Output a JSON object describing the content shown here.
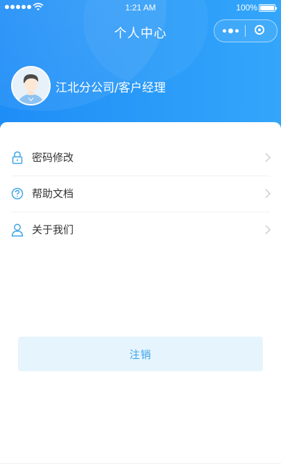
{
  "status_bar": {
    "time": "1:21 AM",
    "battery": "100%"
  },
  "nav": {
    "title": "个人中心"
  },
  "profile": {
    "label": "江北分公司/客户经理"
  },
  "menu": [
    {
      "label": "密码修改",
      "icon": "lock-icon"
    },
    {
      "label": "帮助文档",
      "icon": "question-icon"
    },
    {
      "label": "关于我们",
      "icon": "user-icon"
    }
  ],
  "logout": {
    "label": "注销"
  },
  "colors": {
    "header": "#1e8df7",
    "accent": "#3aa4e8",
    "logout_bg": "#e6f4fd"
  }
}
